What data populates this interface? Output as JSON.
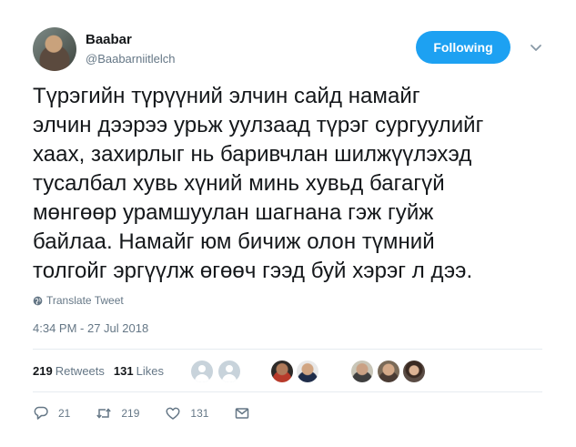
{
  "user": {
    "display_name": "Baabar",
    "handle": "@Baabarniitlelch",
    "follow_label": "Following"
  },
  "tweet": {
    "text": "Түрэгийн түрүүний элчин сайд намайг\nэлчин дээрээ урьж уулзаад түрэг сургуулийг\nхаах, захирлыг нь баривчлан шилжүүлэхэд\nтусалбал хувь хүний минь хувьд багагүй\nмөнгөөр урамшуулан шагнана гэж гуйж\nбайлаа. Намайг юм бичиж олон түмний\nтолгойг эргүүлж өгөөч гээд буй хэрэг л дээ.",
    "translate_label": "Translate Tweet",
    "timestamp": "4:34 PM - 27 Jul 2018"
  },
  "stats": {
    "retweets_count": "219",
    "retweets_label": "Retweets",
    "likes_count": "131",
    "likes_label": "Likes"
  },
  "actions": {
    "reply_count": "21",
    "retweet_count": "219",
    "like_count": "131"
  },
  "icons": {
    "reply": "reply-icon",
    "retweet": "retweet-icon",
    "like": "heart-icon",
    "dm": "envelope-icon",
    "translate": "globe-icon",
    "menu": "chevron-down-icon"
  },
  "colors": {
    "accent": "#1da1f2",
    "secondary_text": "#657786",
    "primary_text": "#14171a",
    "divider": "#e6ecf0"
  }
}
